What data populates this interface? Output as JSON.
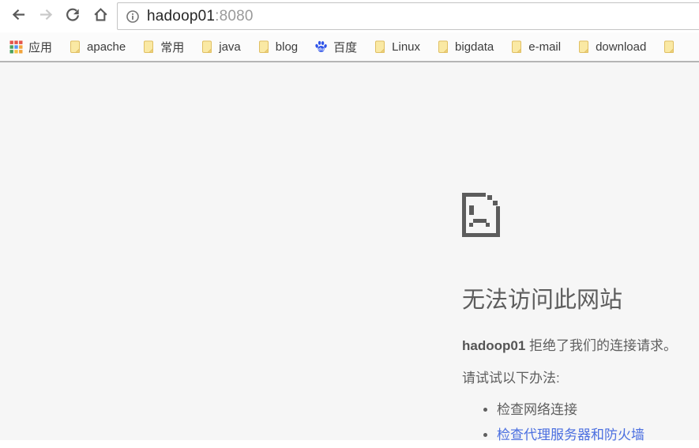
{
  "browser": {
    "address_bar": {
      "host": "hadoop01",
      "port_suffix": ":8080",
      "page_info_icon": "info-circle-icon"
    },
    "nav_icons": {
      "back": "back-arrow-icon",
      "forward": "forward-arrow-icon",
      "reload": "reload-icon",
      "home": "home-icon"
    }
  },
  "bookmarks_bar": {
    "apps_item": {
      "label": "应用",
      "icon": "apps-grid-icon"
    },
    "items": [
      {
        "label": "apache",
        "icon": "folder-icon"
      },
      {
        "label": "常用",
        "icon": "folder-icon"
      },
      {
        "label": "java",
        "icon": "folder-icon"
      },
      {
        "label": "blog",
        "icon": "folder-icon"
      },
      {
        "label": "百度",
        "icon": "baidu-paw-icon"
      },
      {
        "label": "Linux",
        "icon": "folder-icon"
      },
      {
        "label": "bigdata",
        "icon": "folder-icon"
      },
      {
        "label": "e-mail",
        "icon": "folder-icon"
      },
      {
        "label": "download",
        "icon": "folder-icon"
      },
      {
        "label": "",
        "icon": "folder-icon"
      }
    ]
  },
  "error_page": {
    "icon": "sad-file-icon",
    "title": "无法访问此网站",
    "message": {
      "host": "hadoop01",
      "text": " 拒绝了我们的连接请求。"
    },
    "suggestions_heading": "请试试以下办法:",
    "suggestions": [
      {
        "text": "检查网络连接"
      },
      {
        "text": "检查代理服务器和防火墙"
      }
    ]
  },
  "colors": {
    "link_blue": "#4b6fe0",
    "error_text_gray": "#5f5f5f",
    "title_gray": "#5d5d5d",
    "page_background": "#f6f6f6",
    "toolbar_icon_gray": "#5a5a5a",
    "disabled_icon_gray": "#c9c9c9",
    "folder_yellow_fill": "#fae9a4",
    "folder_yellow_border": "#e0bf62",
    "folder_fold": "#edd079",
    "url_port_gray": "#9a9a9a",
    "baidu_blue": "#2f54e8"
  }
}
